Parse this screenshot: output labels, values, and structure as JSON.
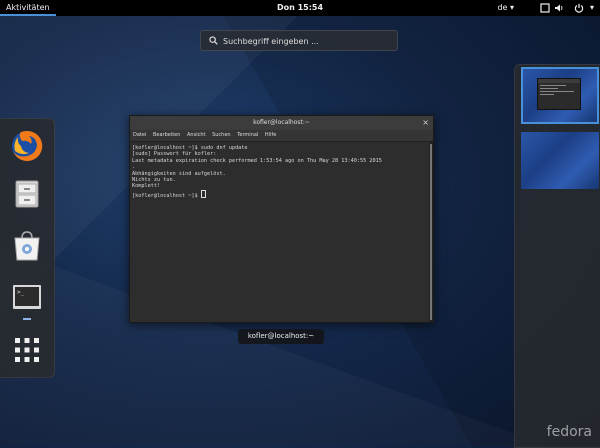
{
  "topbar": {
    "activities": "Aktivitäten",
    "clock": "Don 15:54",
    "language": "de",
    "language_arrow": "▾",
    "power_arrow": "▾"
  },
  "search": {
    "placeholder": "Suchbegriff eingeben ..."
  },
  "dash": {
    "apps": [
      {
        "icon": "firefox-icon"
      },
      {
        "icon": "files-icon"
      },
      {
        "icon": "software-icon"
      },
      {
        "icon": "terminal-icon"
      },
      {
        "icon": "app-grid-icon"
      }
    ]
  },
  "window": {
    "title": "kofler@localhost:~",
    "close": "×",
    "menu": [
      "Datei",
      "Bearbeiten",
      "Ansicht",
      "Suchen",
      "Terminal",
      "Hilfe"
    ],
    "terminal_lines": [
      "[kofler@localhost ~]$ sudo dnf update",
      "[sudo] Passwort für kofler:",
      "Last metadata expiration check performed 1:53:54 ago on Thu May 28 13:40:55 2015",
      ".",
      "Abhängigkeiten sind aufgelöst.",
      "Nichts zu tun.",
      "Komplett!"
    ],
    "prompt": "[kofler@localhost ~]$ ",
    "label": "kofler@localhost:~"
  },
  "branding": "fedora",
  "colors": {
    "accent": "#4a90d9",
    "topbar": "#000000",
    "terminal_bg": "#2d2d2d"
  }
}
